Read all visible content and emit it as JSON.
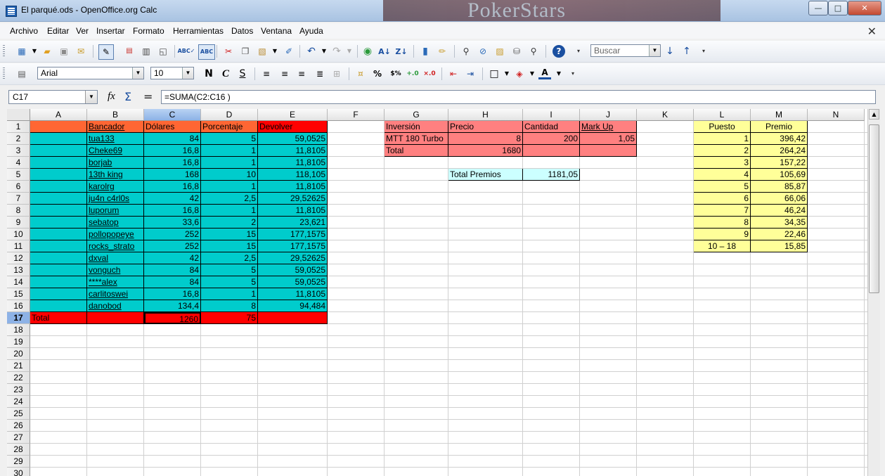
{
  "window": {
    "title": "El parqué.ods - OpenOffice.org Calc",
    "background_text": "PokerStars",
    "btn_minimize": "—",
    "btn_maximize": "□",
    "btn_close": "✕"
  },
  "menu": {
    "items": [
      "Archivo",
      "Editar",
      "Ver",
      "Insertar",
      "Formato",
      "Herramientas",
      "Datos",
      "Ventana",
      "Ayuda"
    ],
    "close_doc": "✕"
  },
  "toolbar": {
    "search_placeholder": "Buscar",
    "font_name": "Arial",
    "font_size": "10",
    "bold": "N",
    "italic": "C",
    "underline": "S",
    "percent": "%"
  },
  "formula_bar": {
    "cell_ref": "C17",
    "fx": "fx",
    "sigma": "Σ",
    "equals": "=",
    "formula": "=SUMA(C2:C16 )"
  },
  "sheet": {
    "columns": [
      "A",
      "B",
      "C",
      "D",
      "E",
      "F",
      "G",
      "H",
      "I",
      "J",
      "K",
      "L",
      "M",
      "N"
    ],
    "rows": [
      "1",
      "2",
      "3",
      "4",
      "5",
      "6",
      "7",
      "8",
      "9",
      "10",
      "11",
      "12",
      "13",
      "14",
      "15",
      "16",
      "17",
      "18",
      "19",
      "20",
      "21",
      "22",
      "23",
      "24",
      "25",
      "26",
      "27",
      "28",
      "29",
      "30"
    ],
    "selected_column": "C",
    "selected_row": "17",
    "main_headers": [
      "Bancador",
      "Dólares",
      "Porcentaje",
      "Devolver"
    ],
    "bankers": [
      {
        "name": "tua133",
        "dollars": "84",
        "percent": "5",
        "return": "59,0525"
      },
      {
        "name": "Cheke69",
        "dollars": "16,8",
        "percent": "1",
        "return": "11,8105"
      },
      {
        "name": "borjab",
        "dollars": "16,8",
        "percent": "1",
        "return": "11,8105"
      },
      {
        "name": "13th king",
        "dollars": "168",
        "percent": "10",
        "return": "118,105"
      },
      {
        "name": "karolrg",
        "dollars": "16,8",
        "percent": "1",
        "return": "11,8105"
      },
      {
        "name": "ju4n c4rl0s",
        "dollars": "42",
        "percent": "2,5",
        "return": "29,52625"
      },
      {
        "name": "luporum",
        "dollars": "16,8",
        "percent": "1",
        "return": "11,8105"
      },
      {
        "name": "sebatop",
        "dollars": "33,6",
        "percent": "2",
        "return": "23,621"
      },
      {
        "name": "pollopopeye",
        "dollars": "252",
        "percent": "15",
        "return": "177,1575"
      },
      {
        "name": "rocks_strato",
        "dollars": "252",
        "percent": "15",
        "return": "177,1575"
      },
      {
        "name": "dxval",
        "dollars": "42",
        "percent": "2,5",
        "return": "29,52625"
      },
      {
        "name": "vonguch",
        "dollars": "84",
        "percent": "5",
        "return": "59,0525"
      },
      {
        "name": "****alex",
        "dollars": "84",
        "percent": "5",
        "return": "59,0525"
      },
      {
        "name": "carlitoswei",
        "dollars": "16,8",
        "percent": "1",
        "return": "11,8105"
      },
      {
        "name": "danobod",
        "dollars": "134,4",
        "percent": "8",
        "return": "94,484"
      }
    ],
    "total": {
      "label": "Total",
      "dollars": "1260",
      "percent": "75"
    },
    "investment": {
      "headers": [
        "Inversión",
        "Precio",
        "Cantidad",
        "Mark Up"
      ],
      "row": {
        "name": "MTT 180 Turbo",
        "price": "8",
        "qty": "200",
        "markup": "1,05"
      },
      "total_label": "Total",
      "total_value": "1680",
      "prize_label": "Total Premios",
      "prize_value": "1181,05"
    },
    "prizes": {
      "headers": [
        "Puesto",
        "Premio"
      ],
      "rows": [
        {
          "place": "1",
          "prize": "396,42"
        },
        {
          "place": "2",
          "prize": "264,24"
        },
        {
          "place": "3",
          "prize": "157,22"
        },
        {
          "place": "4",
          "prize": "105,69"
        },
        {
          "place": "5",
          "prize": "85,87"
        },
        {
          "place": "6",
          "prize": "66,06"
        },
        {
          "place": "7",
          "prize": "46,24"
        },
        {
          "place": "8",
          "prize": "34,35"
        },
        {
          "place": "9",
          "prize": "22,46"
        },
        {
          "place": "10 – 18",
          "prize": "15,85"
        }
      ]
    }
  },
  "colors": {
    "orange_header": "#ff6633",
    "teal": "#00cccc",
    "red": "#ff0000",
    "salmon": "#ff8080",
    "light_cyan": "#ccffff",
    "yellow": "#ffff99"
  }
}
